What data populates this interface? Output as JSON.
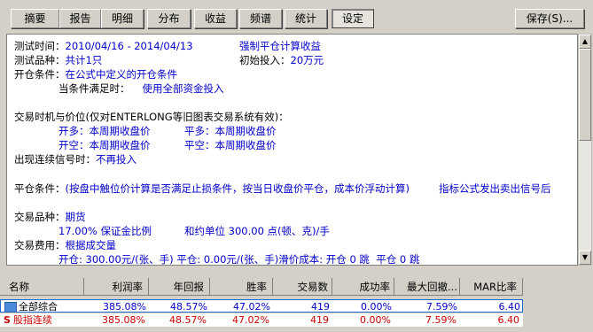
{
  "tabs": [
    "摘要",
    "报告",
    "明细",
    "分布",
    "收益",
    "频谱",
    "统计",
    "设定"
  ],
  "save_label": "保存(S)...",
  "report": {
    "time_label": "测试时间：",
    "time_value": "2010/04/16 - 2014/04/13",
    "forced_close": "强制平仓计算收益",
    "variety_label": "测试品种：",
    "variety_value": "共计1只",
    "init_label": "初始投入：",
    "init_value": "20万元",
    "open_cond_label": "开仓条件：",
    "open_cond_value": "在公式中定义的开仓条件",
    "when_met_label": "当条件满足时：",
    "when_met_value": "使用全部资金投入",
    "timing_title": "交易时机与价位(仅对ENTERLONG等旧图表交易系统有效)：",
    "kai_duo_label": "开多：",
    "kai_duo_value": "本周期收盘价",
    "ping_duo_label": "平多：",
    "ping_duo_value": "本周期收盘价",
    "kai_kong_label": "开空：",
    "kai_kong_value": "本周期收盘价",
    "ping_kong_label": "平空：",
    "ping_kong_value": "本周期收盘价",
    "consec_label": "出现连续信号时：",
    "consec_value": "不再投入",
    "close_cond_label": "平仓条件：",
    "close_cond_value": "(按盘中触位价计算是否满足止损条件，按当日收盘价平仓，成本价浮动计算)",
    "close_cond_extra": "指标公式发出卖出信号后",
    "trade_var_label": "交易品种：",
    "trade_var_value": "期货",
    "margin": "17.00% 保证金比例",
    "contract": "和约单位 300.00 点(顿、克)/手",
    "fee_label": "交易费用：",
    "fee_value": "根据成交量",
    "fee_detail": "开仓: 300.00元/(张、手) 平仓: 0.00元/(张、手)滑价成本: 开仓 0 跳  平仓 0 跳"
  },
  "table": {
    "headers": [
      "名称",
      "利润率",
      "年回报",
      "胜率",
      "交易数",
      "成功率",
      "最大回撤...",
      "MAR比率"
    ],
    "rows": [
      {
        "name": "全部综合",
        "values": [
          "385.08%",
          "48.57%",
          "47.02%",
          "419",
          "0.00%",
          "7.59%",
          "6.40"
        ]
      },
      {
        "name": "股指连续",
        "values": [
          "385.08%",
          "48.57%",
          "47.02%",
          "419",
          "0.00%",
          "7.59%",
          "6.40"
        ]
      }
    ]
  },
  "colors": {
    "text_blue": "#0000cc",
    "selected_row": "#1e6ad6",
    "text_red": "#cc0000"
  }
}
